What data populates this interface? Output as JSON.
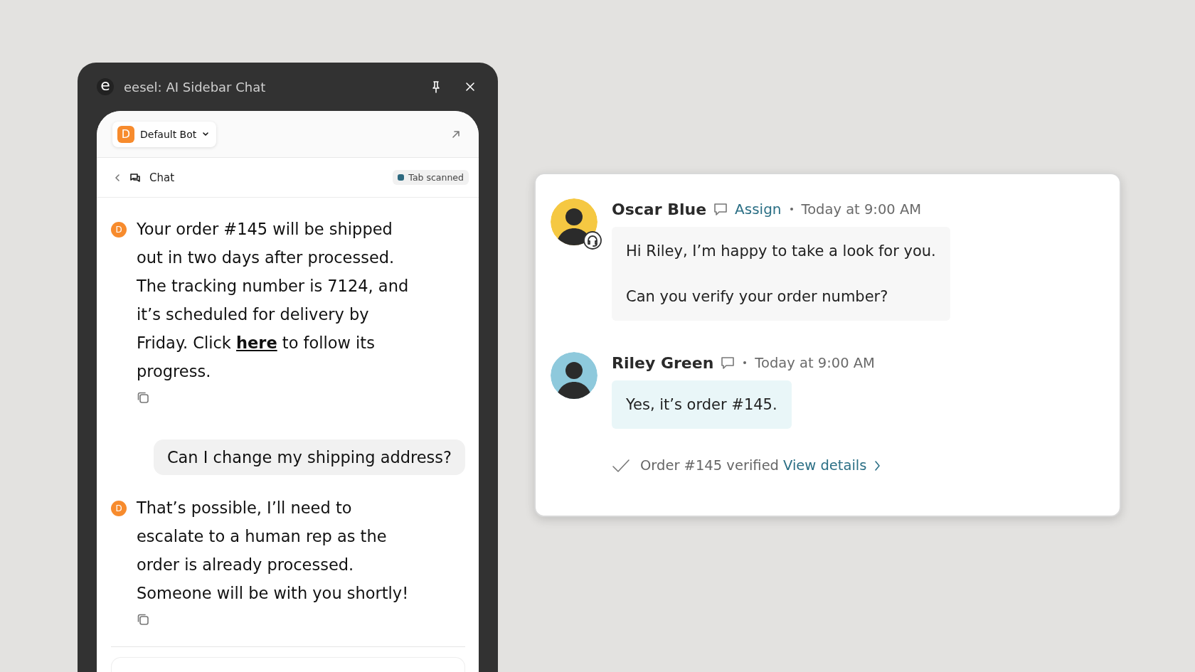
{
  "sidebar": {
    "logo": "e",
    "title": "eesel: AI Sidebar Chat",
    "bot_selector": {
      "initial": "D",
      "label": "Default Bot"
    },
    "nav": {
      "label": "Chat",
      "status": "Tab scanned"
    },
    "messages": [
      {
        "kind": "bot",
        "avatar": "D",
        "text": "Your order #145 will be shipped out in two days after processed. The tracking number is 7124, and it’s scheduled for delivery by Friday. Click",
        "link": "here",
        "text_after": "to follow its progress."
      },
      {
        "kind": "user",
        "text": "Can I change my shipping address?"
      },
      {
        "kind": "bot",
        "avatar": "D",
        "text": "That’s possible, I’ll need to escalate to a human rep as the order is already processed. Someone will be with you shortly!"
      }
    ]
  },
  "conversation": {
    "messages": [
      {
        "author": "Oscar Blue",
        "kind": "agent",
        "color": "#f5c842",
        "action": "Assign",
        "time": "Today at 9:00 AM",
        "paragraphs": [
          "Hi Riley, I’m happy to take a look for you.",
          "Can you verify your order number?"
        ]
      },
      {
        "author": "Riley Green",
        "kind": "customer",
        "color": "#8ec9dc",
        "time": "Today at 9:00 AM",
        "paragraphs": [
          "Yes, it’s order #145."
        ]
      }
    ],
    "verification": {
      "text": "Order #145 verified",
      "link": "View details"
    }
  }
}
